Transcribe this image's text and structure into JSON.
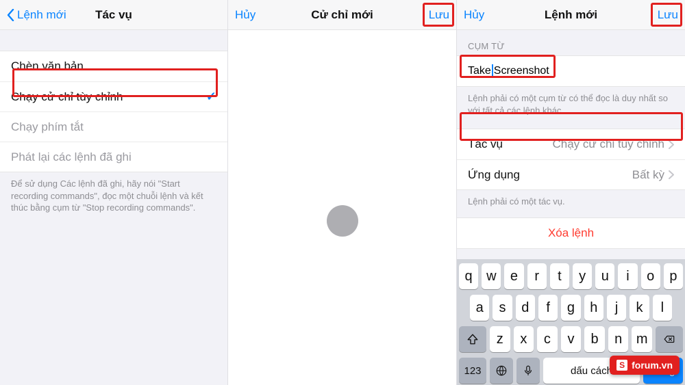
{
  "watermark": "forum.vn",
  "screen1": {
    "nav": {
      "back": "Lệnh mới",
      "title": "Tác vụ"
    },
    "rows": {
      "insert_text": "Chèn văn bản",
      "run_custom_gesture": "Chạy cử chỉ tùy chỉnh",
      "run_shortcut": "Chạy phím tắt",
      "replay_recorded": "Phát lại các lệnh đã ghi"
    },
    "note": "Để sử dụng Các lệnh đã ghi, hãy nói \"Start recording commands\", đọc một chuỗi lệnh và kết thúc bằng cụm từ \"Stop recording commands\"."
  },
  "screen2": {
    "nav": {
      "cancel": "Hủy",
      "title": "Cử chỉ mới",
      "save": "Lưu"
    }
  },
  "screen3": {
    "nav": {
      "cancel": "Hủy",
      "title": "Lệnh mới",
      "save": "Lưu"
    },
    "phrase_header": "CỤM TỪ",
    "phrase_value_pre": "Take ",
    "phrase_value_post": "Screenshot",
    "phrase_note": "Lệnh phải có một cụm từ có thể đọc là duy nhất so với tất cả các lệnh khác.",
    "rows": {
      "action_label": "Tác vụ",
      "action_value": "Chạy cử chỉ tùy chỉnh",
      "app_label": "Ứng dụng",
      "app_value": "Bất kỳ"
    },
    "action_note": "Lệnh phải có một tác vụ.",
    "delete": "Xóa lệnh",
    "keyboard": {
      "row1": [
        "q",
        "w",
        "e",
        "r",
        "t",
        "y",
        "u",
        "i",
        "o",
        "p"
      ],
      "row2": [
        "a",
        "s",
        "d",
        "f",
        "g",
        "h",
        "j",
        "k",
        "l"
      ],
      "row3": [
        "z",
        "x",
        "c",
        "v",
        "b",
        "n",
        "m"
      ],
      "mode": "123",
      "space": "dấu cách",
      "return": "Xong"
    }
  }
}
